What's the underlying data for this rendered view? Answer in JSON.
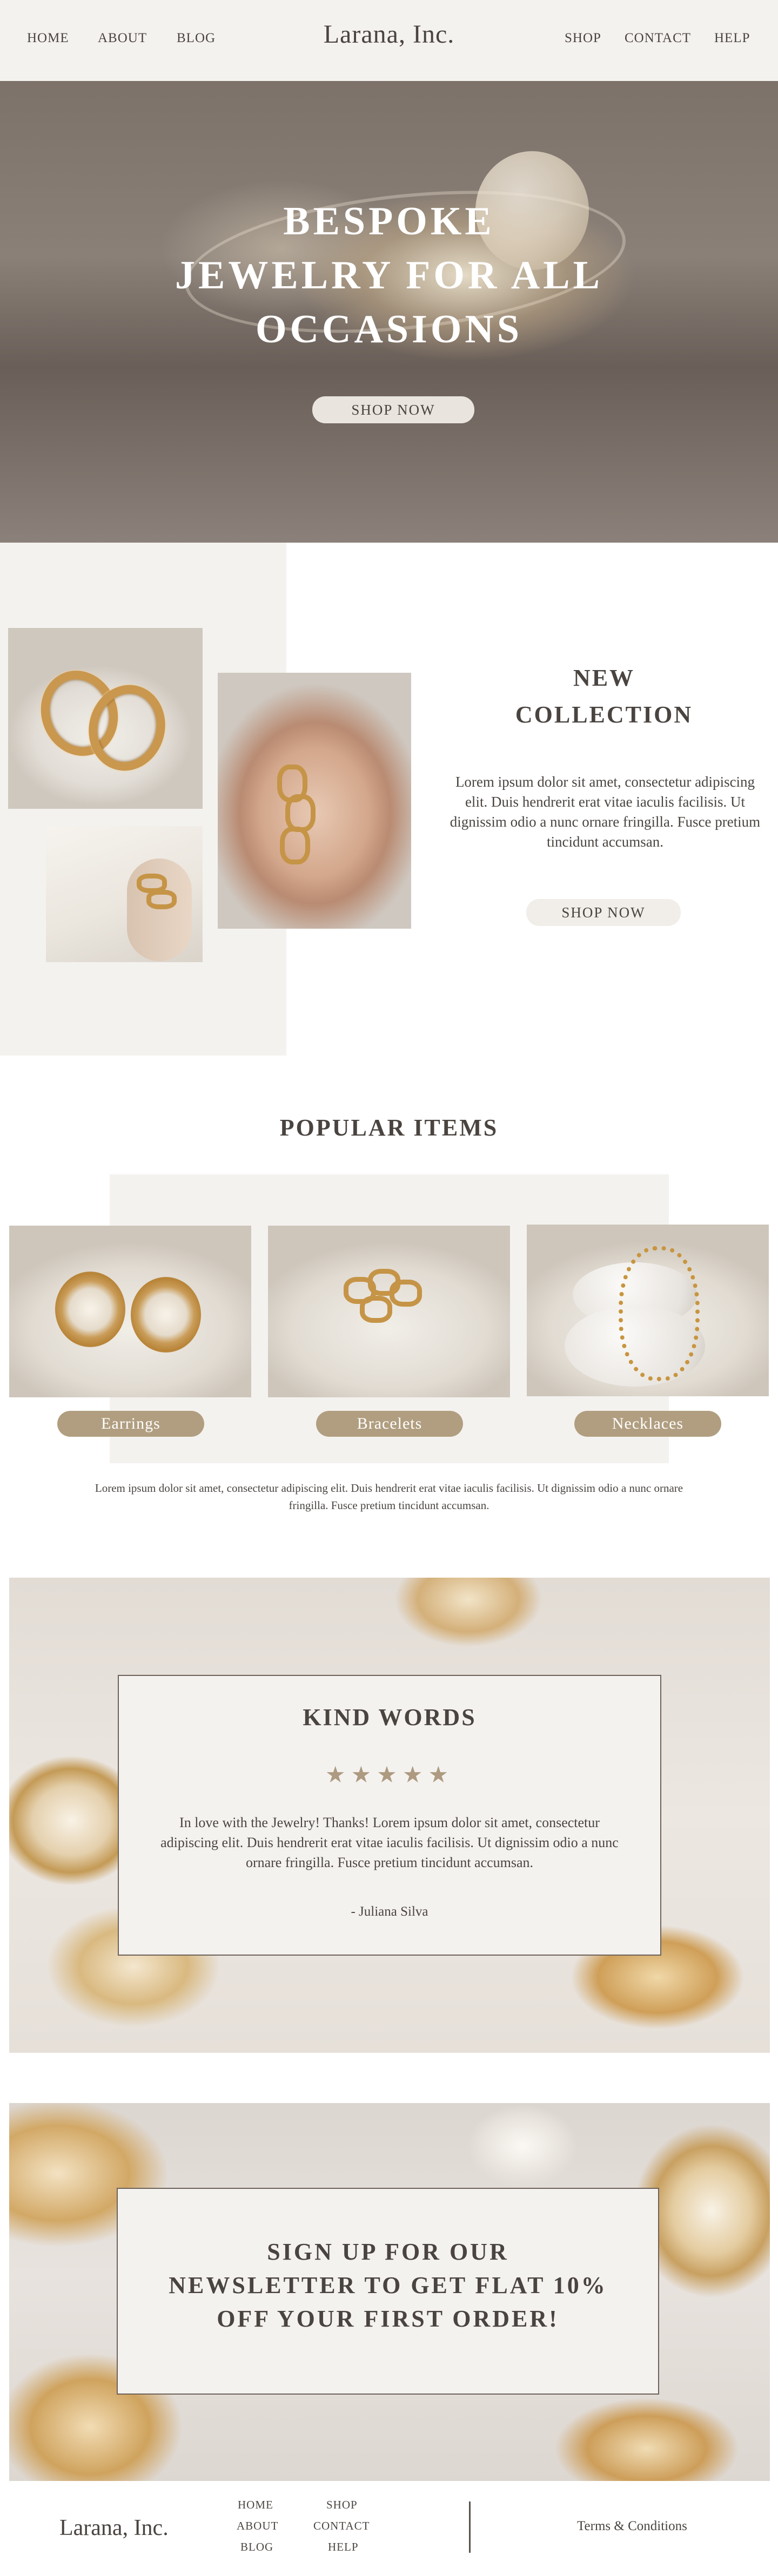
{
  "nav": {
    "left": [
      "HOME",
      "ABOUT",
      "BLOG"
    ],
    "logo": "Larana, Inc.",
    "right": [
      "SHOP",
      "CONTACT",
      "HELP"
    ]
  },
  "hero": {
    "title": "BESPOKE\nJEWELRY FOR ALL\nOCCASIONS",
    "button": "SHOP NOW"
  },
  "new_collection": {
    "title": "NEW\nCOLLECTION",
    "text": "Lorem ipsum dolor sit amet, consectetur adipiscing elit. Duis hendrerit erat vitae iaculis facilisis. Ut dignissim odio a nunc ornare fringilla. Fusce pretium tincidunt accumsan.",
    "button": "SHOP NOW"
  },
  "popular": {
    "title": "POPULAR ITEMS",
    "items": [
      "Earrings",
      "Bracelets",
      "Necklaces"
    ],
    "note": "Lorem ipsum dolor sit amet, consectetur adipiscing elit. Duis hendrerit erat vitae iaculis facilisis. Ut dignissim odio a nunc ornare fringilla. Fusce pretium tincidunt accumsan."
  },
  "kind_words": {
    "title": "KIND WORDS",
    "stars": "★★★★★",
    "rating": 5,
    "text": "In love with the Jewelry! Thanks! Lorem ipsum dolor sit amet, consectetur adipiscing elit. Duis hendrerit erat vitae iaculis facilisis. Ut dignissim odio a nunc ornare fringilla. Fusce pretium tincidunt accumsan.",
    "author": "- Juliana Silva"
  },
  "newsletter": {
    "title": "SIGN UP FOR OUR\nNEWSLETTER TO GET FLAT 10%\nOFF YOUR FIRST ORDER!"
  },
  "footer": {
    "logo": "Larana, Inc.",
    "col1": [
      "HOME",
      "ABOUT",
      "BLOG"
    ],
    "col2": [
      "SHOP",
      "CONTACT",
      "HELP"
    ],
    "terms": "Terms & Conditions"
  },
  "colors": {
    "background": "#ffffff",
    "cream": "#f4f2ef",
    "text": "#4a4440",
    "accent": "#b19e80",
    "star": "#ad9a80"
  }
}
